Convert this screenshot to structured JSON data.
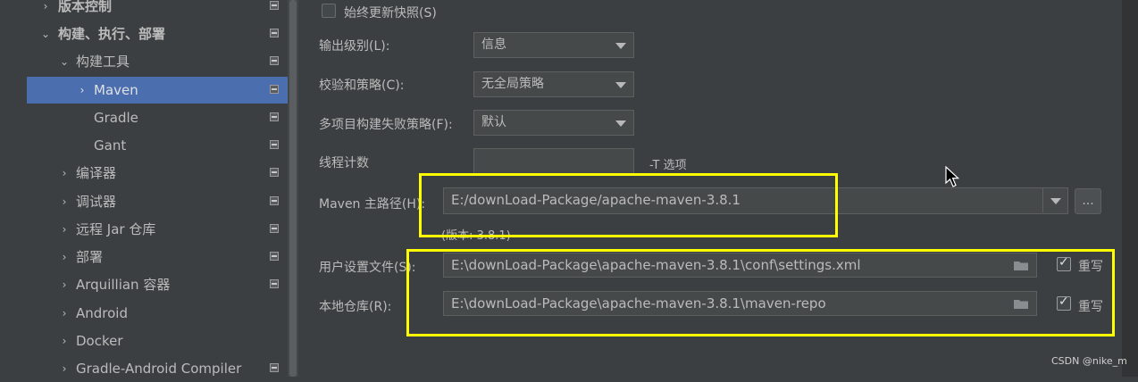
{
  "sidebar": {
    "items": [
      {
        "label": "版本控制",
        "arrow": "›",
        "bold": true
      },
      {
        "label": "构建、执行、部署",
        "arrow": "⌄",
        "bold": true
      },
      {
        "label": "构建工具",
        "arrow": "⌄"
      },
      {
        "label": "Maven",
        "arrow": "›",
        "selected": true
      },
      {
        "label": "Gradle",
        "arrow": ""
      },
      {
        "label": "Gant",
        "arrow": ""
      },
      {
        "label": "编译器",
        "arrow": "›"
      },
      {
        "label": "调试器",
        "arrow": "›"
      },
      {
        "label": "远程 Jar 仓库",
        "arrow": "›"
      },
      {
        "label": "部署",
        "arrow": "›"
      },
      {
        "label": "Arquillian 容器",
        "arrow": "›"
      },
      {
        "label": "Android",
        "arrow": "›"
      },
      {
        "label": "Docker",
        "arrow": "›"
      },
      {
        "label": "Gradle-Android Compiler",
        "arrow": "›"
      }
    ]
  },
  "settings": {
    "always_update_snapshots": {
      "label": "始终更新快照(S)",
      "checked": false
    },
    "output_level": {
      "label": "输出级别(L):",
      "value": "信息"
    },
    "checksum_policy": {
      "label": "校验和策略(C):",
      "value": "无全局策略"
    },
    "multiproject_fail_policy": {
      "label": "多项目构建失败策略(F):",
      "value": "默认"
    },
    "thread_count": {
      "label": "线程计数",
      "value": "",
      "hint": "-T 选项"
    },
    "maven_home": {
      "label": "Maven 主路径(H):",
      "value": "E:/downLoad-Package/apache-maven-3.8.1",
      "browse": "...",
      "version": "(版本: 3.8.1)"
    },
    "user_settings": {
      "label": "用户设置文件(S):",
      "value": "E:\\downLoad-Package\\apache-maven-3.8.1\\conf\\settings.xml",
      "override_label": "重写",
      "override": true
    },
    "local_repo": {
      "label": "本地仓库(R):",
      "value": "E:\\downLoad-Package\\apache-maven-3.8.1\\maven-repo",
      "override_label": "重写",
      "override": true
    }
  },
  "watermark": "CSDN @nike_m",
  "colors": {
    "selection": "#4b6eaf",
    "highlight": "#ffff00",
    "background": "#3c3f41"
  }
}
